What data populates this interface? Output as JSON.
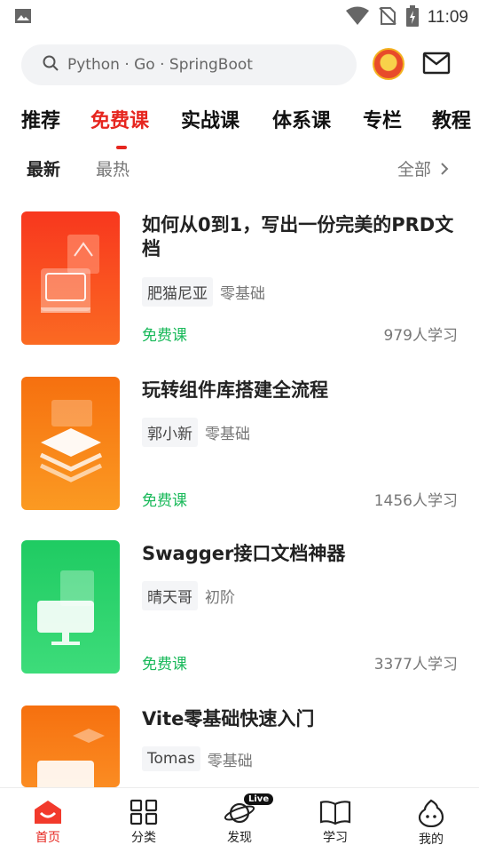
{
  "status_bar": {
    "time": "11:09"
  },
  "search": {
    "placeholder": "Python · Go · SpringBoot"
  },
  "categories": [
    {
      "label": "推荐"
    },
    {
      "label": "免费课",
      "active": true
    },
    {
      "label": "实战课"
    },
    {
      "label": "体系课"
    },
    {
      "label": "专栏"
    },
    {
      "label": "教程"
    }
  ],
  "sort": {
    "latest": "最新",
    "hottest": "最热",
    "all": "全部"
  },
  "courses": [
    {
      "title": "如何从0到1，写出一份完美的PRD文档",
      "teacher": "肥猫尼亚",
      "level": "零基础",
      "price": "免费课",
      "learners": "979人学习",
      "thumb_icon": "PDF",
      "thumb_color": "#f5421f"
    },
    {
      "title": "玩转组件库搭建全流程",
      "teacher": "郭小新",
      "level": "零基础",
      "price": "免费课",
      "learners": "1456人学习",
      "thumb_icon": "</>",
      "thumb_color": "#f77b14"
    },
    {
      "title": "Swagger接口文档神器",
      "teacher": "晴天哥",
      "level": "初阶",
      "price": "免费课",
      "learners": "3377人学习",
      "thumb_icon": "Swagger",
      "thumb_color": "#25cc5e"
    },
    {
      "title": "Vite零基础快速入门",
      "teacher": "Tomas",
      "level": "零基础",
      "price": "",
      "learners": "",
      "thumb_icon": "",
      "thumb_color": "#f77b14"
    }
  ],
  "bottom_nav": [
    {
      "label": "首页",
      "icon": "home-icon",
      "active": true
    },
    {
      "label": "分类",
      "icon": "grid-icon"
    },
    {
      "label": "发现",
      "icon": "planet-icon",
      "badge": "Live"
    },
    {
      "label": "学习",
      "icon": "book-icon"
    },
    {
      "label": "我的",
      "icon": "profile-icon"
    }
  ]
}
